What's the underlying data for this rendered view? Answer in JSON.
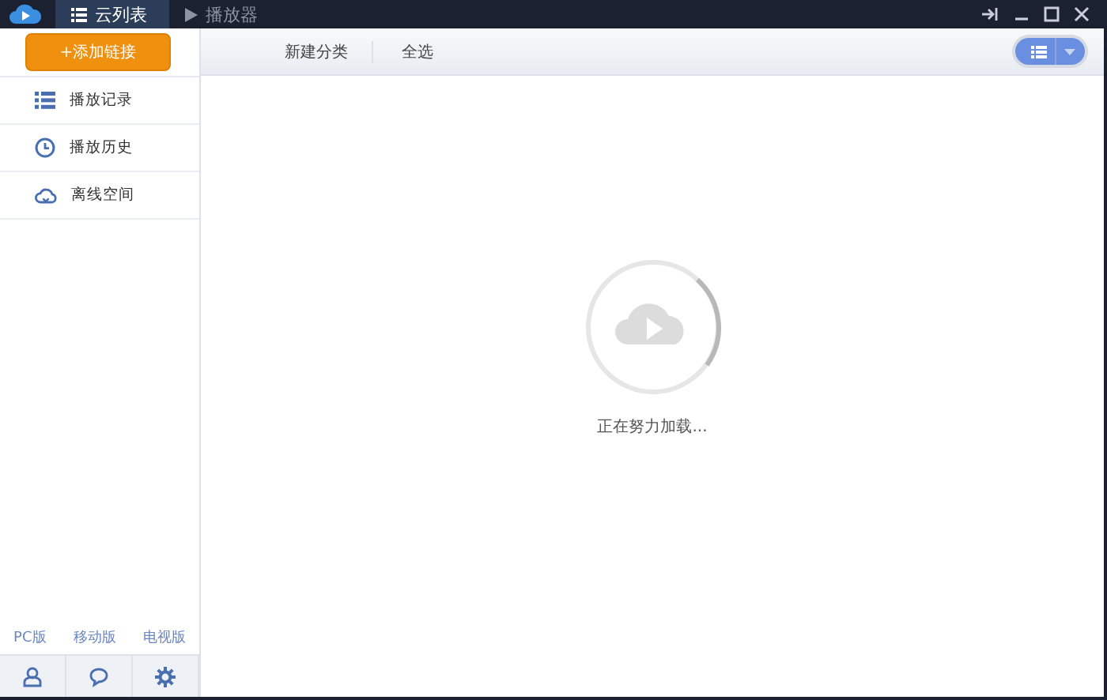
{
  "tabs": [
    {
      "label": "云列表",
      "kind": "list",
      "selected": true
    },
    {
      "label": "播放器",
      "kind": "play",
      "selected": false
    }
  ],
  "sidebar": {
    "add_button": "+添加链接",
    "items": [
      {
        "label": "播放记录",
        "kind": "list"
      },
      {
        "label": "播放历史",
        "kind": "clock"
      },
      {
        "label": "离线空间",
        "kind": "cloud"
      }
    ],
    "versions": [
      "PC版",
      "移动版",
      "电视版"
    ]
  },
  "toolbar": {
    "actions": [
      "新建分类",
      "全选"
    ]
  },
  "loading": {
    "text": "正在努力加载..."
  }
}
